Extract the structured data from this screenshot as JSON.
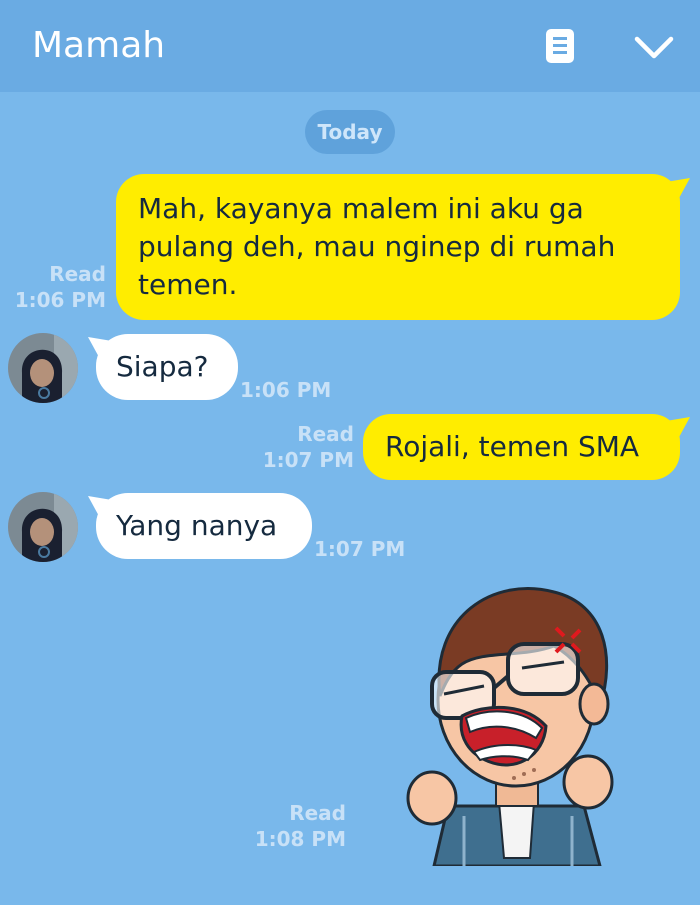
{
  "header": {
    "title": "Mamah",
    "icons": [
      "memo-icon",
      "chevron-down-icon"
    ]
  },
  "date_label": "Today",
  "messages": [
    {
      "side": "out",
      "text": "Mah, kayanya malem ini aku ga pulang deh, mau nginep di rumah temen.",
      "status": "Read",
      "time": "1:06 PM"
    },
    {
      "side": "in",
      "text": "Siapa?",
      "time": "1:06 PM"
    },
    {
      "side": "out",
      "text": "Rojali, temen SMA",
      "status": "Read",
      "time": "1:07 PM"
    },
    {
      "side": "in",
      "text": "Yang nanya",
      "time": "1:07 PM"
    },
    {
      "side": "out",
      "type": "sticker",
      "sticker": "angry-boy-sticker",
      "status": "Read",
      "time": "1:08 PM"
    }
  ],
  "colors": {
    "background": "#79b8eb",
    "header": "#6aabe3",
    "outgoing_bubble": "#ffed00",
    "incoming_bubble": "#ffffff",
    "meta_text": "#c8e1f7"
  }
}
